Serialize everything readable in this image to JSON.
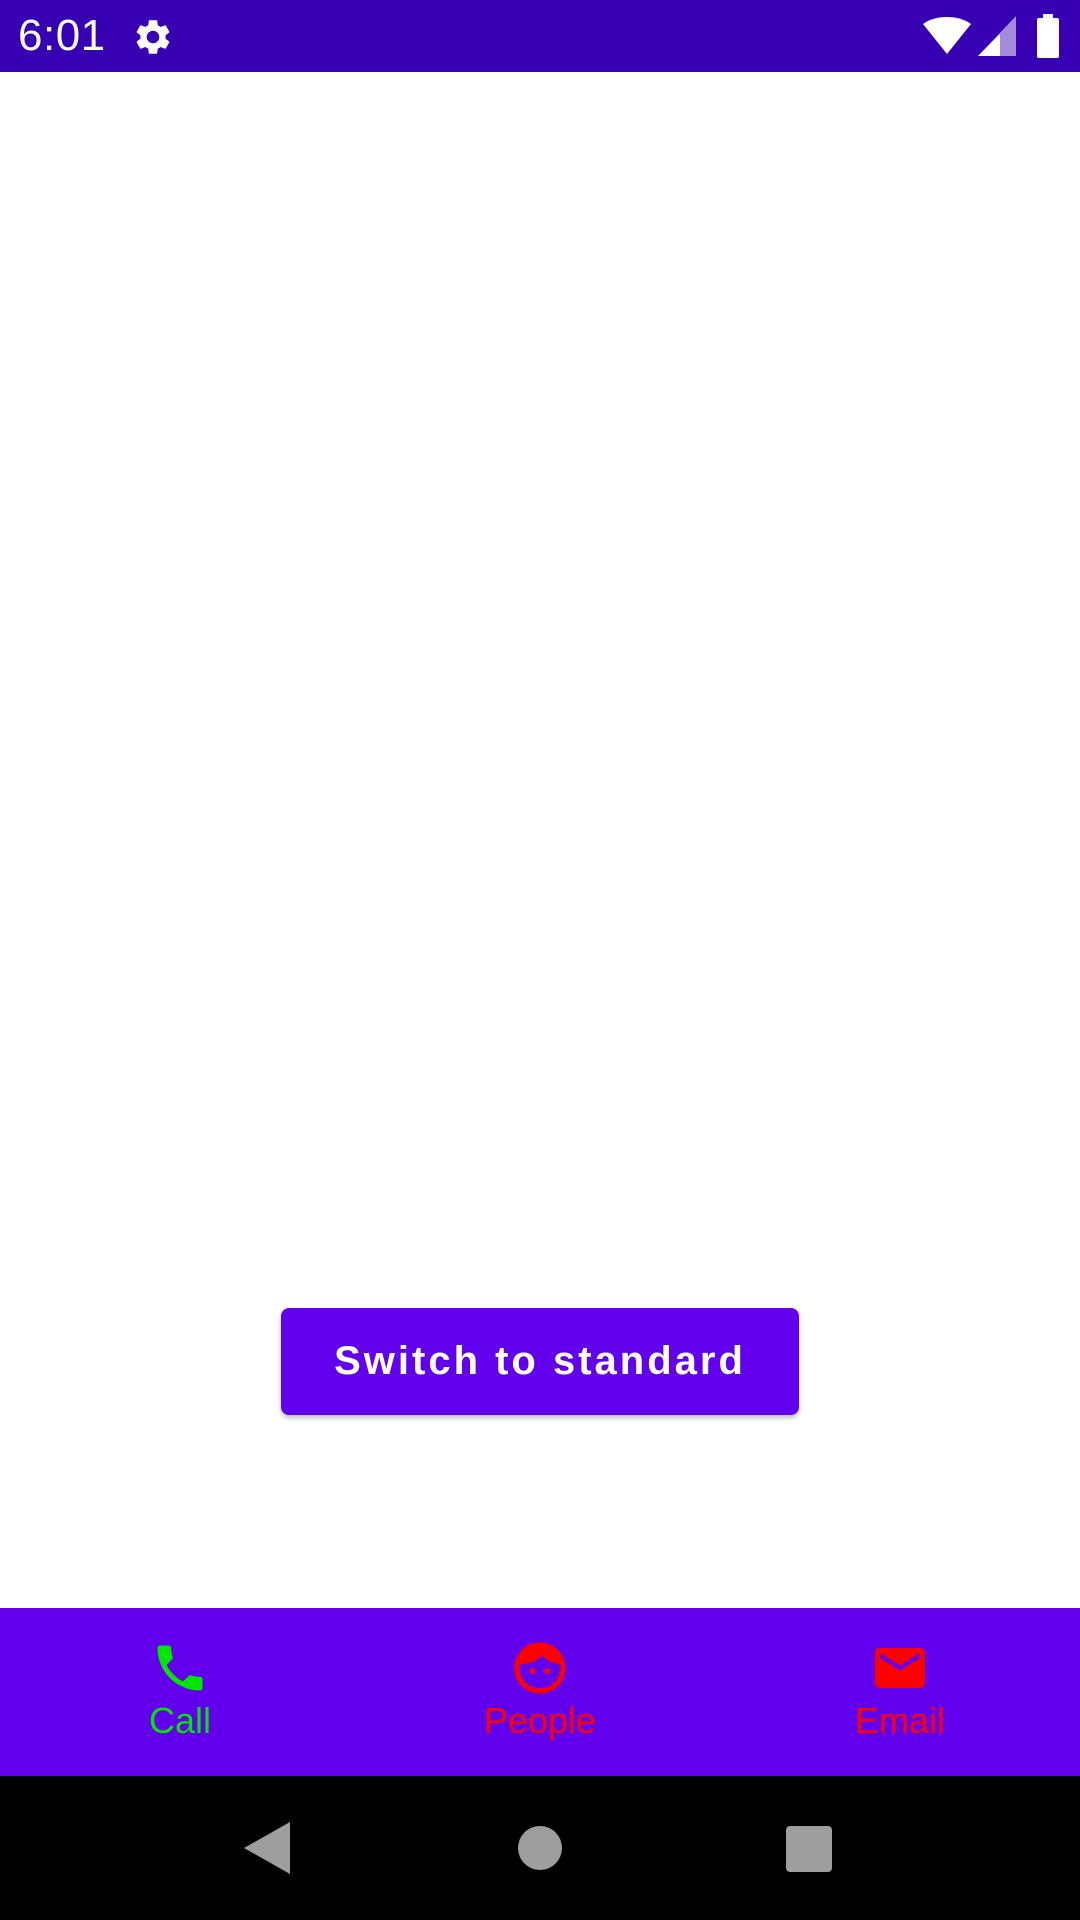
{
  "status_bar": {
    "time": "6:01",
    "icons": [
      "gear-icon",
      "wifi-icon",
      "cellular-signal-icon",
      "battery-icon"
    ],
    "background_color": "#3700b3"
  },
  "main": {
    "switch_button_label": "Switch to standard",
    "button_color": "#6200ee"
  },
  "bottom_nav": {
    "background_color": "#6200ee",
    "items": [
      {
        "label": "Call",
        "icon": "phone-icon",
        "color": "#00e600"
      },
      {
        "label": "People",
        "icon": "face-icon",
        "color": "#ff0000"
      },
      {
        "label": "Email",
        "icon": "mail-icon",
        "color": "#ff0000"
      }
    ]
  },
  "system_nav": {
    "buttons": [
      "back-icon",
      "home-icon",
      "recents-icon"
    ]
  }
}
